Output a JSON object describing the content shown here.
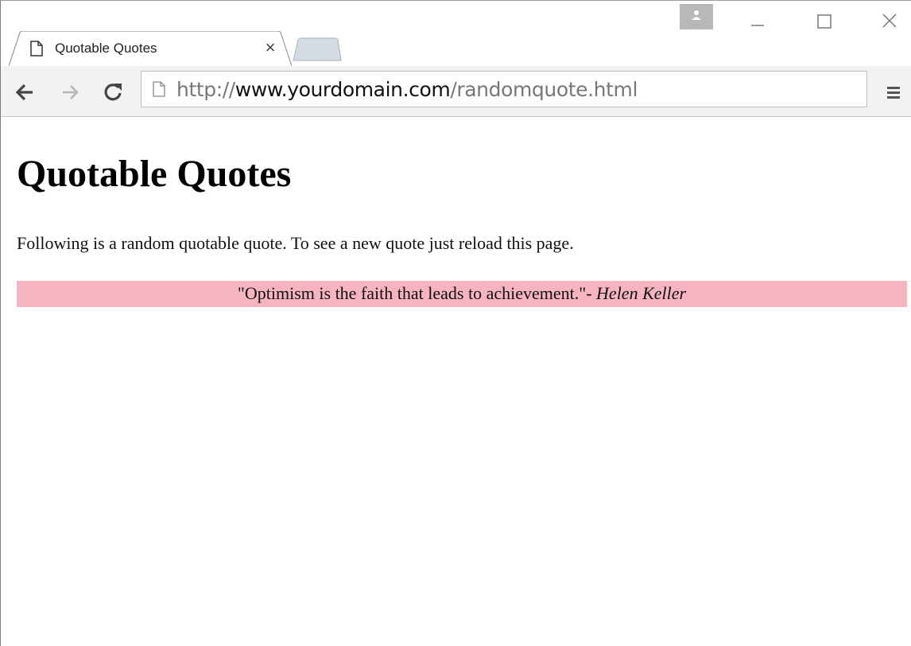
{
  "browser": {
    "tab": {
      "title": "Quotable Quotes",
      "close_glyph": "×",
      "page_icon": "document-icon"
    },
    "window_controls": {
      "profile": "person-icon",
      "minimize": "minimize-icon",
      "maximize": "maximize-icon",
      "close": "close-icon"
    },
    "toolbar": {
      "back": "arrow-left-icon",
      "forward": "arrow-right-icon",
      "reload": "reload-icon",
      "menu": "hamburger-menu-icon"
    },
    "address_bar": {
      "scheme": "http://",
      "host": "www.yourdomain.com",
      "path": "/randomquote.html"
    }
  },
  "page": {
    "heading": "Quotable Quotes",
    "intro": "Following is a random quotable quote. To see a new quote just reload this page.",
    "quote": {
      "text": "\"Optimism is the faith that leads to achievement.\"- ",
      "author": "Helen Keller",
      "background": "#f5b4c0"
    }
  }
}
